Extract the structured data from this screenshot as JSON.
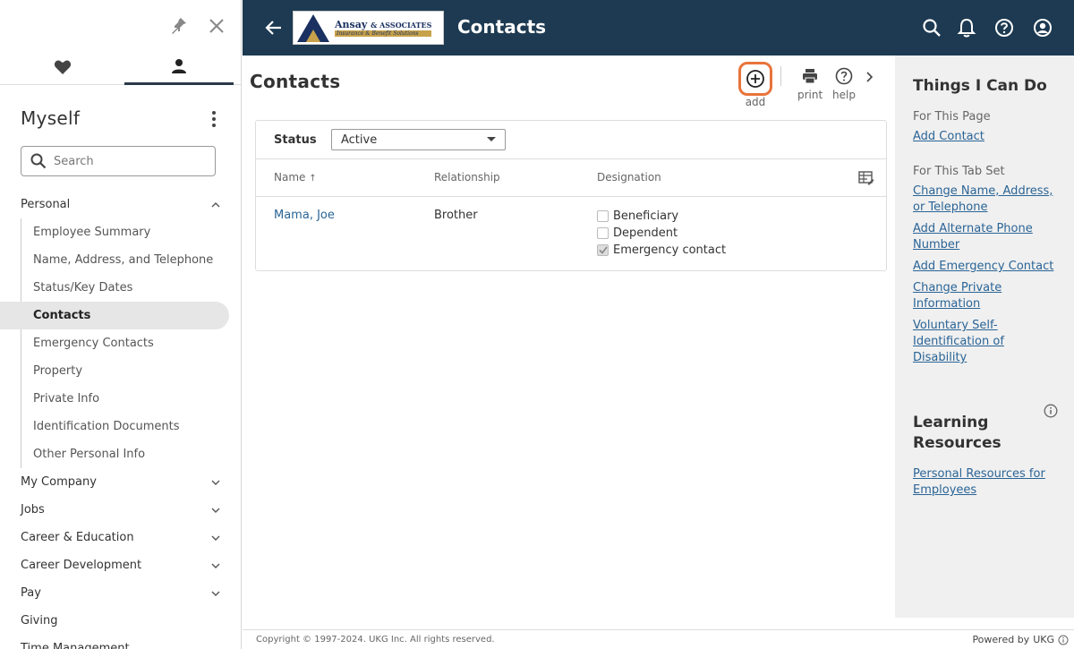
{
  "sidebar": {
    "title": "Myself",
    "search_placeholder": "Search",
    "sections": [
      {
        "label": "Personal",
        "expanded": true
      },
      {
        "label": "My Company"
      },
      {
        "label": "Jobs"
      },
      {
        "label": "Career & Education"
      },
      {
        "label": "Career Development"
      },
      {
        "label": "Pay"
      },
      {
        "label": "Giving"
      },
      {
        "label": "Time Management"
      }
    ],
    "personal_items": [
      "Employee Summary",
      "Name, Address, and Telephone",
      "Status/Key Dates",
      "Contacts",
      "Emergency Contacts",
      "Property",
      "Private Info",
      "Identification Documents",
      "Other Personal Info"
    ],
    "active_item": "Contacts"
  },
  "header": {
    "title": "Contacts",
    "logo_name": "Ansay",
    "logo_name_suffix": "& ASSOCIATES",
    "logo_sub": "Insurance & Benefit Solutions"
  },
  "main": {
    "page_title": "Contacts",
    "tools": {
      "add": "add",
      "print": "print",
      "help": "help"
    },
    "status_label": "Status",
    "status_value": "Active",
    "columns": {
      "name": "Name",
      "name_sort": "↑",
      "relationship": "Relationship",
      "designation": "Designation"
    },
    "rows": [
      {
        "name": "Mama, Joe",
        "relationship": "Brother",
        "designations": [
          {
            "label": "Beneficiary",
            "checked": false
          },
          {
            "label": "Dependent",
            "checked": false
          },
          {
            "label": "Emergency contact",
            "checked": true
          }
        ]
      }
    ]
  },
  "right_panel": {
    "heading": "Things I Can Do",
    "for_page": "For This Page",
    "page_links": [
      "Add Contact"
    ],
    "for_tab_set": "For This Tab Set",
    "tab_links": [
      "Change Name, Address, or Telephone",
      "Add Alternate Phone Number",
      "Add Emergency Contact",
      "Change Private Information",
      "Voluntary Self-Identification of Disability"
    ],
    "learning_heading": "Learning Resources",
    "learning_links": [
      "Personal Resources for Employees"
    ]
  },
  "footer": {
    "copyright": "Copyright © 1997-2024. UKG Inc. All rights reserved.",
    "powered_by": "Powered by",
    "brand": "UKG"
  },
  "colors": {
    "header_bg": "#1d3a52",
    "accent_highlight": "#e8743b",
    "link": "#2a6496",
    "panel_bg": "#f0f0f0"
  }
}
